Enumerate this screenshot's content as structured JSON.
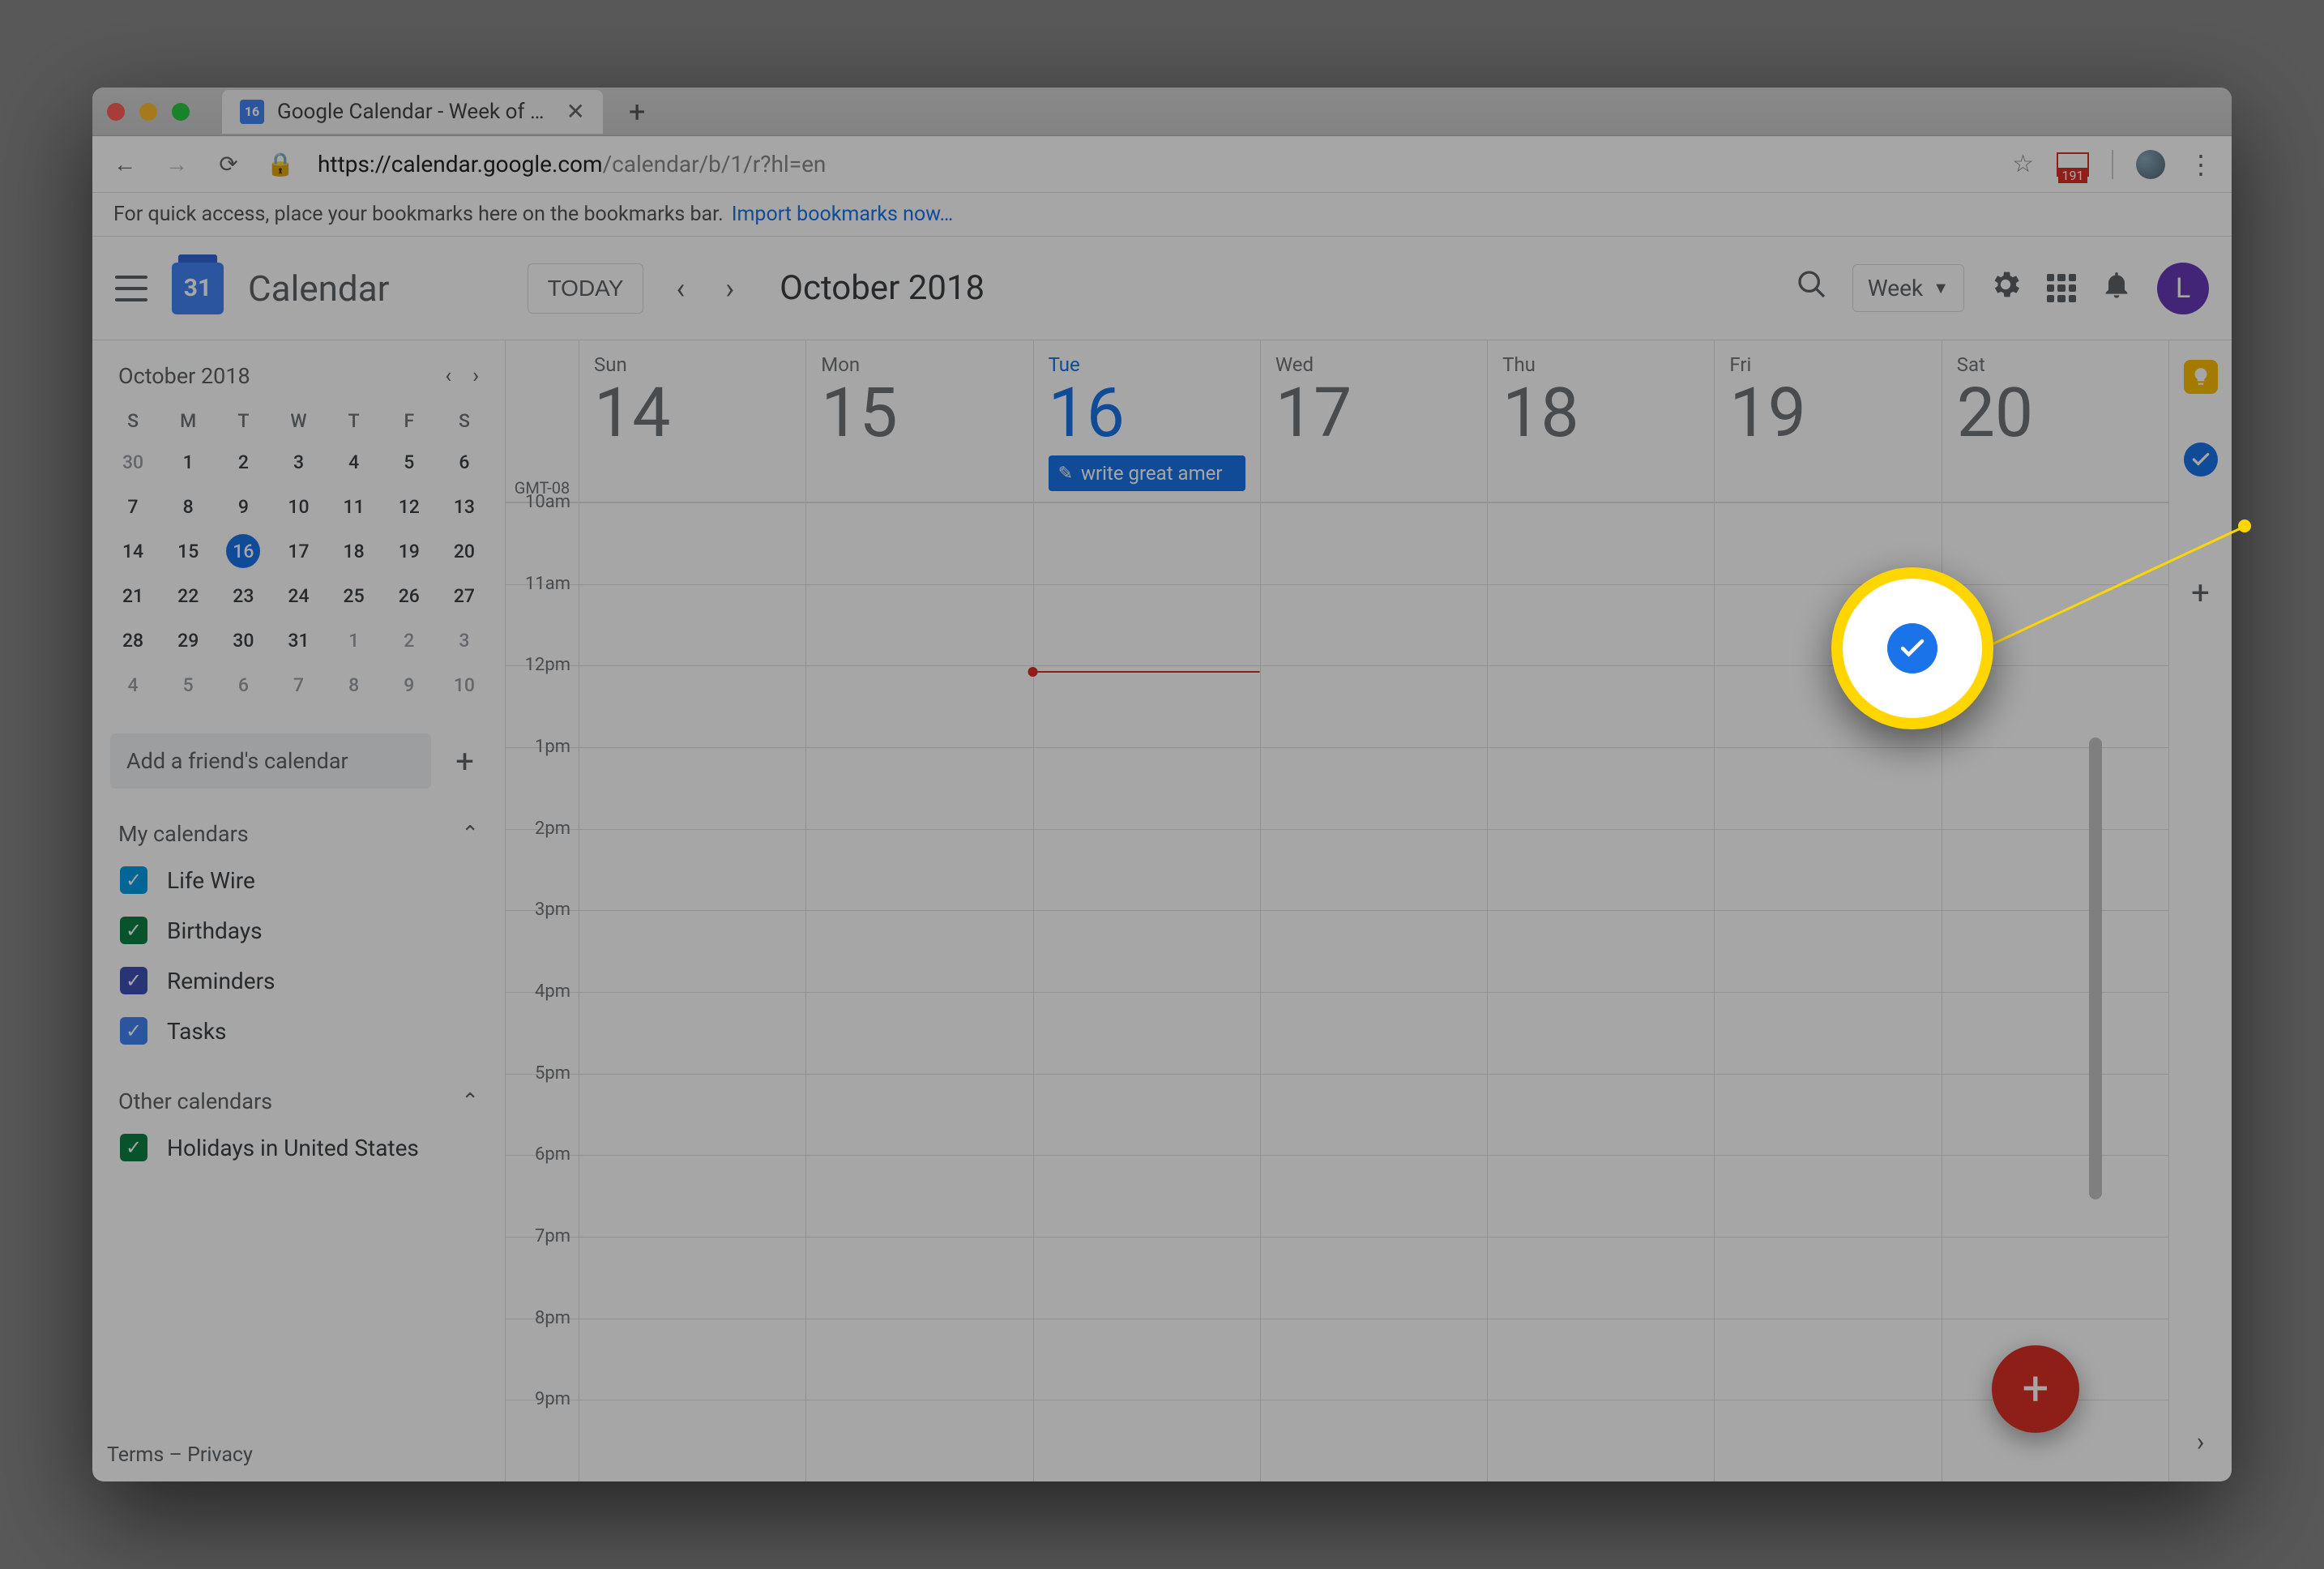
{
  "browser": {
    "tab_title": "Google Calendar - Week of Oc",
    "favicon_text": "16",
    "url_host": "https://calendar.google.com",
    "url_path": "/calendar/b/1/r?hl=en",
    "gmail_count": "191",
    "bookmark_hint": "For quick access, place your bookmarks here on the bookmarks bar.",
    "bookmark_link": "Import bookmarks now…"
  },
  "header": {
    "app_title": "Calendar",
    "logo_day": "31",
    "today_label": "TODAY",
    "period": "October 2018",
    "view_label": "Week",
    "avatar_letter": "L"
  },
  "mini": {
    "title": "October 2018",
    "dows": [
      "S",
      "M",
      "T",
      "W",
      "T",
      "F",
      "S"
    ],
    "rows": [
      [
        {
          "n": "30",
          "dim": true
        },
        {
          "n": "1"
        },
        {
          "n": "2"
        },
        {
          "n": "3"
        },
        {
          "n": "4"
        },
        {
          "n": "5"
        },
        {
          "n": "6"
        }
      ],
      [
        {
          "n": "7"
        },
        {
          "n": "8"
        },
        {
          "n": "9"
        },
        {
          "n": "10"
        },
        {
          "n": "11"
        },
        {
          "n": "12"
        },
        {
          "n": "13"
        }
      ],
      [
        {
          "n": "14"
        },
        {
          "n": "15"
        },
        {
          "n": "16",
          "today": true
        },
        {
          "n": "17"
        },
        {
          "n": "18"
        },
        {
          "n": "19"
        },
        {
          "n": "20"
        }
      ],
      [
        {
          "n": "21"
        },
        {
          "n": "22"
        },
        {
          "n": "23"
        },
        {
          "n": "24"
        },
        {
          "n": "25"
        },
        {
          "n": "26"
        },
        {
          "n": "27"
        }
      ],
      [
        {
          "n": "28"
        },
        {
          "n": "29"
        },
        {
          "n": "30"
        },
        {
          "n": "31"
        },
        {
          "n": "1",
          "dim": true
        },
        {
          "n": "2",
          "dim": true
        },
        {
          "n": "3",
          "dim": true
        }
      ],
      [
        {
          "n": "4",
          "dim": true
        },
        {
          "n": "5",
          "dim": true
        },
        {
          "n": "6",
          "dim": true
        },
        {
          "n": "7",
          "dim": true
        },
        {
          "n": "8",
          "dim": true
        },
        {
          "n": "9",
          "dim": true
        },
        {
          "n": "10",
          "dim": true
        }
      ]
    ]
  },
  "addfriend_placeholder": "Add a friend's calendar",
  "mycals": {
    "title": "My calendars",
    "items": [
      {
        "label": "Life Wire",
        "color": "#039be5"
      },
      {
        "label": "Birthdays",
        "color": "#0b8043"
      },
      {
        "label": "Reminders",
        "color": "#3f51b5"
      },
      {
        "label": "Tasks",
        "color": "#4285f4"
      }
    ]
  },
  "othercals": {
    "title": "Other calendars",
    "items": [
      {
        "label": "Holidays in United States",
        "color": "#0b8043"
      }
    ]
  },
  "footer": {
    "terms": "Terms",
    "dash": "–",
    "privacy": "Privacy"
  },
  "week": {
    "gmt": "GMT-08",
    "days": [
      {
        "dow": "Sun",
        "num": "14"
      },
      {
        "dow": "Mon",
        "num": "15"
      },
      {
        "dow": "Tue",
        "num": "16",
        "today": true,
        "allday": "write great amer"
      },
      {
        "dow": "Wed",
        "num": "17"
      },
      {
        "dow": "Thu",
        "num": "18"
      },
      {
        "dow": "Fri",
        "num": "19"
      },
      {
        "dow": "Sat",
        "num": "20"
      }
    ],
    "hours": [
      "10am",
      "11am",
      "12pm",
      "1pm",
      "2pm",
      "3pm",
      "4pm",
      "5pm",
      "6pm",
      "7pm",
      "8pm",
      "9pm"
    ]
  }
}
